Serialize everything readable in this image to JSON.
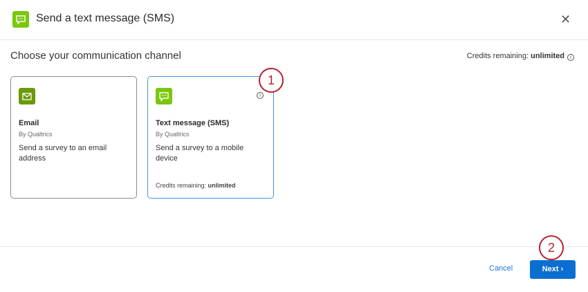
{
  "header": {
    "title": "Send a text message (SMS)",
    "close_icon": "close-icon"
  },
  "main": {
    "subtitle": "Choose your communication channel",
    "credits_label": "Credits remaining:",
    "credits_value": "unlimited",
    "cards": [
      {
        "name": "Email",
        "by": "By Qualtrics",
        "desc": "Send a survey to an email address",
        "icon": "envelope-icon",
        "color": "#6a9a0a"
      },
      {
        "name": "Text message (SMS)",
        "by": "By Qualtrics",
        "desc": "Send a survey to a mobile device",
        "icon": "chat-bubble-icon",
        "color": "#7ac70c",
        "credits_label": "Credits remaining:",
        "credits_value": "unlimited"
      }
    ]
  },
  "annotations": [
    "1",
    "2"
  ],
  "footer": {
    "cancel": "Cancel",
    "next": "Next"
  },
  "colors": {
    "accent": "#0b6fd1",
    "selected_border": "#4a90e2",
    "annotation": "#b5202e"
  }
}
